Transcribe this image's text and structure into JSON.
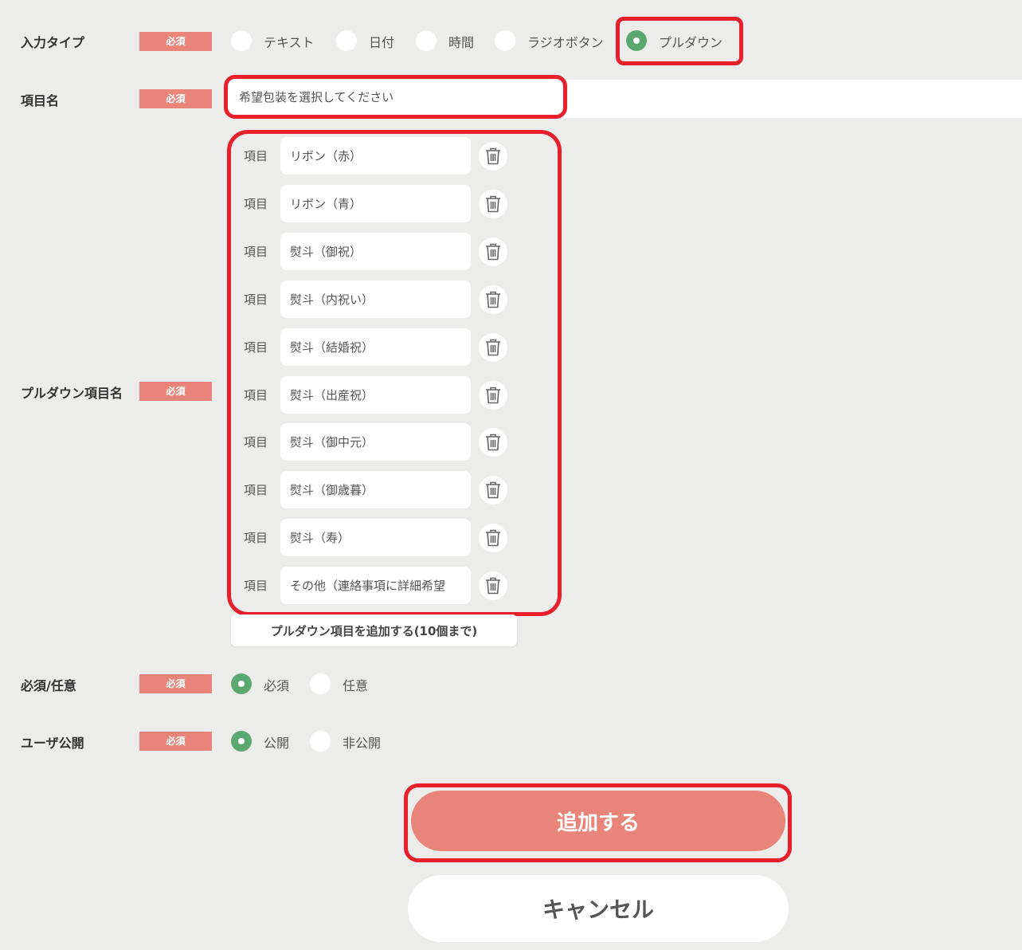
{
  "required_badge": "必須",
  "input_type": {
    "label": "入力タイプ",
    "options": [
      {
        "label": "テキスト",
        "checked": false
      },
      {
        "label": "日付",
        "checked": false
      },
      {
        "label": "時間",
        "checked": false
      },
      {
        "label": "ラジオボタン",
        "checked": false
      },
      {
        "label": "プルダウン",
        "checked": true
      }
    ]
  },
  "item_name": {
    "label": "項目名",
    "value": "希望包装を選択してください"
  },
  "pulldown": {
    "label": "プルダウン項目名",
    "row_label": "項目",
    "items": [
      "リボン（赤）",
      "リボン（青）",
      "熨斗（御祝）",
      "熨斗（内祝い）",
      "熨斗（結婚祝）",
      "熨斗（出産祝）",
      "熨斗（御中元）",
      "熨斗（御歳暮）",
      "熨斗（寿）",
      "その他（連絡事項に詳細希望"
    ],
    "add_button": "プルダウン項目を追加する(10個まで)"
  },
  "required_optional": {
    "label": "必須/任意",
    "options": [
      {
        "label": "必須",
        "checked": true
      },
      {
        "label": "任意",
        "checked": false
      }
    ]
  },
  "user_public": {
    "label": "ユーザ公開",
    "options": [
      {
        "label": "公開",
        "checked": true
      },
      {
        "label": "非公開",
        "checked": false
      }
    ]
  },
  "submit_button": "追加する",
  "cancel_button": "キャンセル",
  "colors": {
    "background": "#ececea",
    "accent": "#e8847a",
    "radio_checked": "#5aa870",
    "highlight": "#e8202c"
  }
}
